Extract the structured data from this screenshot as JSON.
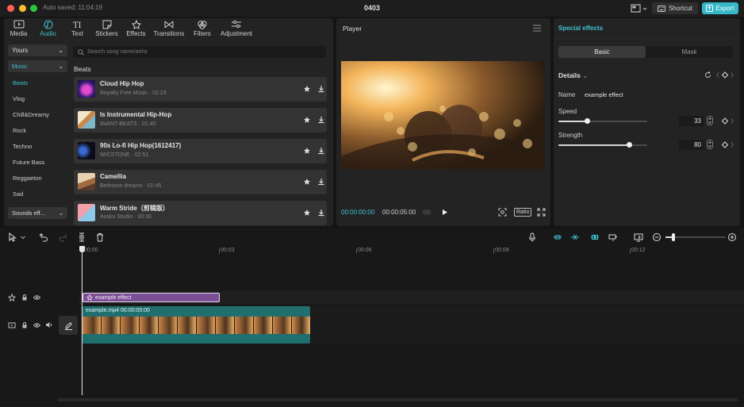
{
  "window": {
    "autosave": "Auto saved: 11:04:19",
    "title": "0403",
    "shortcut_label": "Shortcut",
    "export_label": "Export",
    "traffic": {
      "close": "#ff5f57",
      "min": "#febc2e",
      "max": "#28c840"
    }
  },
  "media": {
    "tabs": [
      {
        "label": "Media",
        "icon": "media-icon"
      },
      {
        "label": "Audio",
        "icon": "audio-icon"
      },
      {
        "label": "Text",
        "icon": "text-icon"
      },
      {
        "label": "Stickers",
        "icon": "stickers-icon"
      },
      {
        "label": "Effects",
        "icon": "effects-icon"
      },
      {
        "label": "Transitions",
        "icon": "transitions-icon"
      },
      {
        "label": "Filters",
        "icon": "filters-icon"
      },
      {
        "label": "Adjustment",
        "icon": "adjustment-icon"
      }
    ],
    "active_tab": "Audio",
    "yours_label": "Yours",
    "music_label": "Music",
    "categories": [
      "Beats",
      "Vlog",
      "Chill&Dreamy",
      "Rock",
      "Techno",
      "Future Bass",
      "Reggaeton",
      "Sad"
    ],
    "selected_category": "Beats",
    "sounds_label": "Sounds eff...",
    "search_placeholder": "Search song name/artist",
    "section_title": "Beats",
    "songs": [
      {
        "title": "Cloud Hip Hop",
        "meta": "Royalty Free Music · 02:23"
      },
      {
        "title": "Is Instrumental Hip-Hop",
        "meta": "AVANT-BEATS · 01:40"
      },
      {
        "title": "90s Lo-fi Hip Hop(1612417)",
        "meta": "WICSTONE · 02:51"
      },
      {
        "title": "Camellia",
        "meta": "Bedroom dreams · 01:45"
      },
      {
        "title": "Warm Stride（剪辑版）",
        "meta": "Ausku Studio · 00:30"
      }
    ]
  },
  "player": {
    "title": "Player",
    "current_time": "00:00:00:00",
    "total_time": "00:00:05:00",
    "ratio_label": "Ratio"
  },
  "effects": {
    "title": "Special effects",
    "segments": [
      "Basic",
      "Mask"
    ],
    "active_segment": "Basic",
    "details_label": "Details",
    "name_label": "Name",
    "name_value": "example effect",
    "speed_label": "Speed",
    "speed_value": "33",
    "speed_fraction": 0.33,
    "strength_label": "Strength",
    "strength_value": "80",
    "strength_fraction": 0.8
  },
  "timeline": {
    "ruler": [
      "00:00",
      "00:03",
      "00:06",
      "00:09",
      "00:12"
    ],
    "effect_clip_label": "example effect",
    "video_clip_label": "example.mp4   00:00:05:00"
  }
}
